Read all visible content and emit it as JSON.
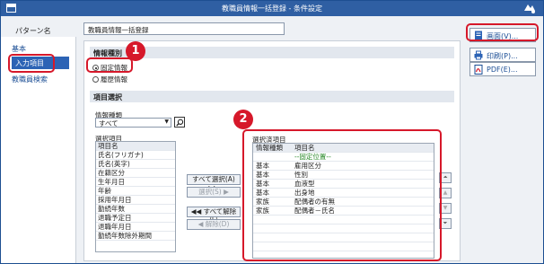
{
  "window": {
    "title": "教職員情報一括登録 - 条件設定"
  },
  "pattern": {
    "label": "パターン名",
    "value": "教職員情報一括登録"
  },
  "sidebar": {
    "items": [
      {
        "label": "基本"
      },
      {
        "label": "入力項目"
      },
      {
        "label": "教職員検索"
      }
    ]
  },
  "info_type": {
    "heading": "情報種別",
    "options": [
      {
        "label": "固定情報",
        "selected": true
      },
      {
        "label": "履歴情報",
        "selected": false
      }
    ]
  },
  "item_select": {
    "heading": "項目選択",
    "category_label": "情報種類",
    "category_value": "すべて",
    "available_label": "選択項目",
    "available_header": "項目名",
    "available_items": [
      "氏名(フリガナ)",
      "氏名(英字)",
      "在籍区分",
      "生年月日",
      "年齢",
      "採用年月日",
      "勤続年数",
      "退職予定日",
      "退職年月日",
      "勤続年数除外期間"
    ],
    "buttons": {
      "select_all": "すべて選択(A)",
      "select": "選択(S)",
      "clear_all": "すべて解除(L)",
      "clear": "解除(D)"
    },
    "selected_label": "選択済項目",
    "selected_headers": [
      "情報種類",
      "項目名"
    ],
    "selected_rows": [
      {
        "type": "",
        "name": "--固定位置--"
      },
      {
        "type": "基本",
        "name": "雇用区分"
      },
      {
        "type": "基本",
        "name": "性別"
      },
      {
        "type": "基本",
        "name": "血液型"
      },
      {
        "type": "基本",
        "name": "出身地"
      },
      {
        "type": "家族",
        "name": "配偶者の有無"
      },
      {
        "type": "家族",
        "name": "配偶者－氏名"
      }
    ]
  },
  "actions": {
    "screen": "画面(V)...",
    "print": "印刷(P)...",
    "pdf": "PDF(E)..."
  },
  "callouts": [
    "1",
    "2"
  ],
  "colors": {
    "accent": "#2f5fa3",
    "highlight": "#d6182a"
  }
}
